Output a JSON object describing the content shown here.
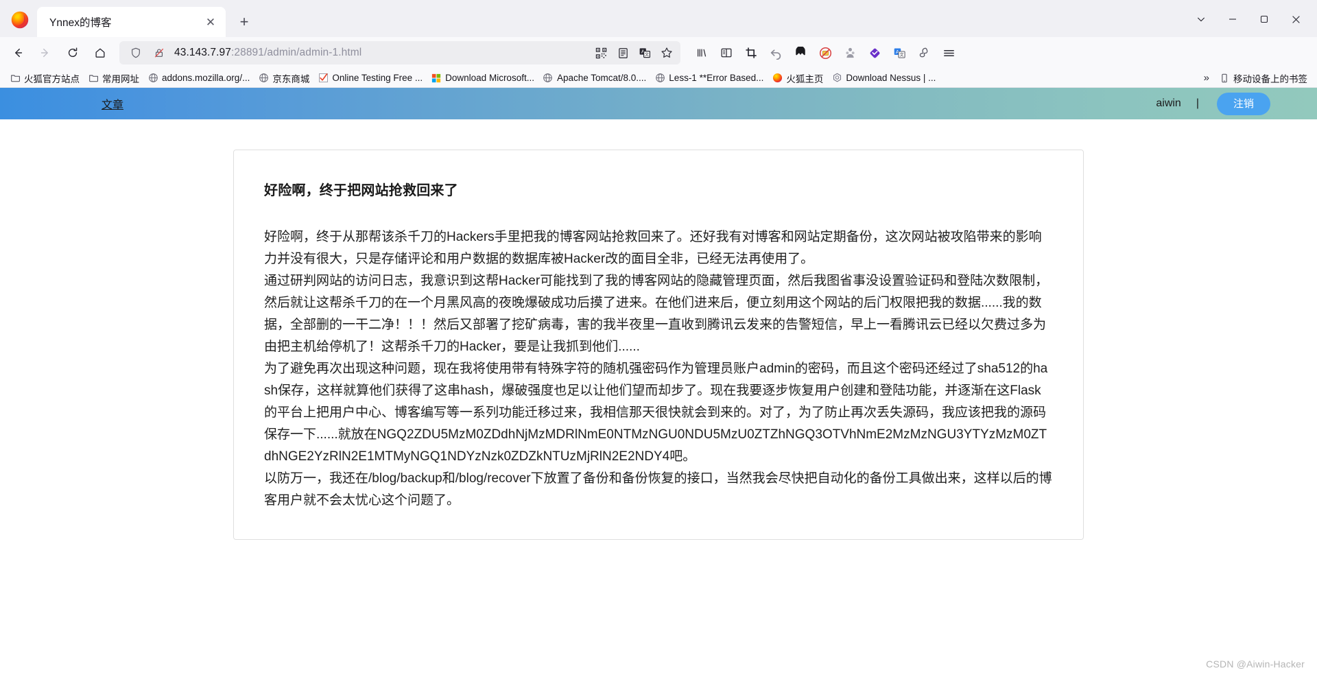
{
  "browser": {
    "tab": {
      "title": "Ynnex的博客",
      "close_label": "✕",
      "newtab_label": "+"
    },
    "window_controls": {
      "list_all_tabs": "list-all-tabs",
      "minimize": "—",
      "maximize": "□",
      "close": "✕"
    },
    "nav": {
      "back": "back-arrow",
      "forward": "forward-arrow",
      "reload": "reload",
      "home": "home"
    },
    "url": {
      "value": "43.143.7.97:28891/admin/admin-1.html",
      "host": "43.143.7.97",
      "path": ":28891/admin/admin-1.html",
      "shield_icon": "tracking-protection-shield",
      "lock_icon": "insecure-connection-lock",
      "right_icons": [
        "qrcode-icon",
        "reader-mode-icon",
        "translate-icon",
        "bookmark-star-icon"
      ]
    },
    "toolbar_right_icons": [
      "library-icon",
      "sidebar-icon",
      "screenshot-crop-icon",
      "undo-arrow-icon",
      "mask-extension-icon",
      "adblock-extension-icon",
      "privacy-spy-icon",
      "violet-diamond-extension-icon",
      "translate-extension-icon",
      "proxy-extension-icon",
      "app-menu-icon"
    ],
    "bookmarks": [
      {
        "label": "火狐官方站点",
        "icon": "folder-icon"
      },
      {
        "label": "常用网址",
        "icon": "folder-icon"
      },
      {
        "label": "addons.mozilla.org/...",
        "icon": "globe-icon"
      },
      {
        "label": "京东商城",
        "icon": "globe-icon"
      },
      {
        "label": "Online Testing Free ...",
        "icon": "checkmark-icon"
      },
      {
        "label": "Download Microsoft...",
        "icon": "microsoft-icon"
      },
      {
        "label": "Apache Tomcat/8.0....",
        "icon": "globe-icon"
      },
      {
        "label": "Less-1 **Error Based...",
        "icon": "globe-icon"
      },
      {
        "label": "火狐主页",
        "icon": "firefox-icon"
      },
      {
        "label": "Download Nessus | ...",
        "icon": "nessus-icon"
      }
    ],
    "bookmarks_overflow": "»",
    "mobile_bookmarks": {
      "label": "移动设备上的书签",
      "icon": "mobile-icon"
    }
  },
  "site": {
    "nav": {
      "brand_link": "文章",
      "username": "aiwin",
      "separator": "|",
      "logout_label": "注销"
    },
    "article": {
      "title": "好险啊，终于把网站抢救回来了",
      "paragraphs": [
        "好险啊，终于从那帮该杀千刀的Hackers手里把我的博客网站抢救回来了。还好我有对博客和网站定期备份，这次网站被攻陷带来的影响力并没有很大，只是存储评论和用户数据的数据库被Hacker改的面目全非，已经无法再使用了。",
        "通过研判网站的访问日志，我意识到这帮Hacker可能找到了我的博客网站的隐藏管理页面，然后我图省事没设置验证码和登陆次数限制，然后就让这帮杀千刀的在一个月黑风高的夜晚爆破成功后摸了进来。在他们进来后，便立刻用这个网站的后门权限把我的数据......我的数据，全部删的一干二净！！！然后又部署了挖矿病毒，害的我半夜里一直收到腾讯云发来的告警短信，早上一看腾讯云已经以欠费过多为由把主机给停机了！这帮杀千刀的Hacker，要是让我抓到他们......",
        "为了避免再次出现这种问题，现在我将使用带有特殊字符的随机强密码作为管理员账户admin的密码，而且这个密码还经过了sha512的hash保存，这样就算他们获得了这串hash，爆破强度也足以让他们望而却步了。现在我要逐步恢复用户创建和登陆功能，并逐渐在这Flask的平台上把用户中心、博客编写等一系列功能迁移过来，我相信那天很快就会到来的。对了，为了防止再次丢失源码，我应该把我的源码保存一下......就放在NGQ2ZDU5MzM0ZDdhNjMzMDRlNmE0NTMzNGU0NDU5MzU0ZTZhNGQ3OTVhNmE2MzMzNGU3YTYzMzM0ZTdhNGE2YzRlN2E1MTMyNGQ1NDYzNzk0ZDZkNTUzMjRlN2E2NDY4吧。",
        "以防万一，我还在/blog/backup和/blog/recover下放置了备份和备份恢复的接口，当然我会尽快把自动化的备份工具做出来，这样以后的博客用户就不会太忧心这个问题了。"
      ]
    }
  },
  "watermark": "CSDN @Aiwin-Hacker",
  "colors": {
    "nav_gradient_start": "#3b8fe0",
    "nav_gradient_end": "#92c9bd",
    "logout_button": "#4aa3f0",
    "chrome_bg": "#f9f9fb",
    "tabstrip_bg": "#f0f0f4"
  }
}
